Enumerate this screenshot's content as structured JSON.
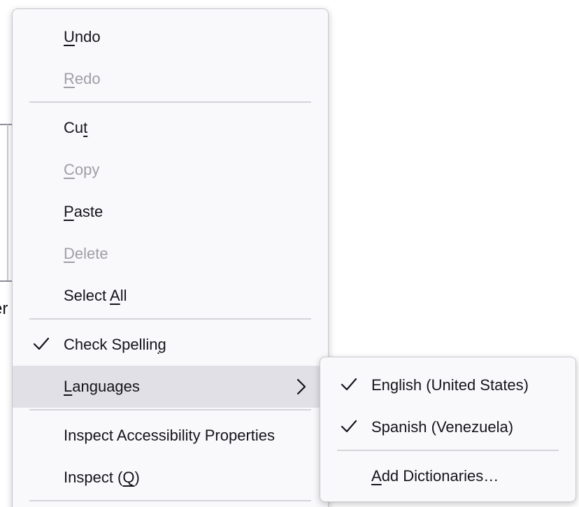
{
  "background": {
    "fragment_text": "er"
  },
  "context_menu": {
    "items": [
      {
        "pre": "",
        "key": "U",
        "post": "ndo"
      },
      {
        "pre": "",
        "key": "R",
        "post": "edo"
      },
      {
        "pre": "Cu",
        "key": "t",
        "post": ""
      },
      {
        "pre": "",
        "key": "C",
        "post": "opy"
      },
      {
        "pre": "",
        "key": "P",
        "post": "aste"
      },
      {
        "pre": "",
        "key": "D",
        "post": "elete"
      },
      {
        "pre": "Select ",
        "key": "A",
        "post": "ll"
      },
      {
        "pre": "Check Spellin",
        "key": "g",
        "post": ""
      },
      {
        "pre": "",
        "key": "L",
        "post": "anguages"
      },
      {
        "pre": "Inspect Accessibility Properties",
        "key": "",
        "post": ""
      },
      {
        "pre": "Inspect (",
        "key": "Q",
        "post": ")"
      }
    ]
  },
  "languages_submenu": {
    "items": [
      {
        "pre": "English (United States)",
        "key": "",
        "post": ""
      },
      {
        "pre": "Spanish (Venezuela)",
        "key": "",
        "post": ""
      },
      {
        "pre": "",
        "key": "A",
        "post": "dd Dictionaries…"
      }
    ]
  },
  "icons": {
    "check": "checkmark-icon",
    "submenu_arrow": "chevron-right-icon"
  },
  "colors": {
    "menu_bg": "#f9f9fb",
    "text": "#15141a",
    "disabled_text": "#9e9ea6",
    "highlight_bg": "#e0e0e6",
    "separator": "#d4d4da"
  }
}
